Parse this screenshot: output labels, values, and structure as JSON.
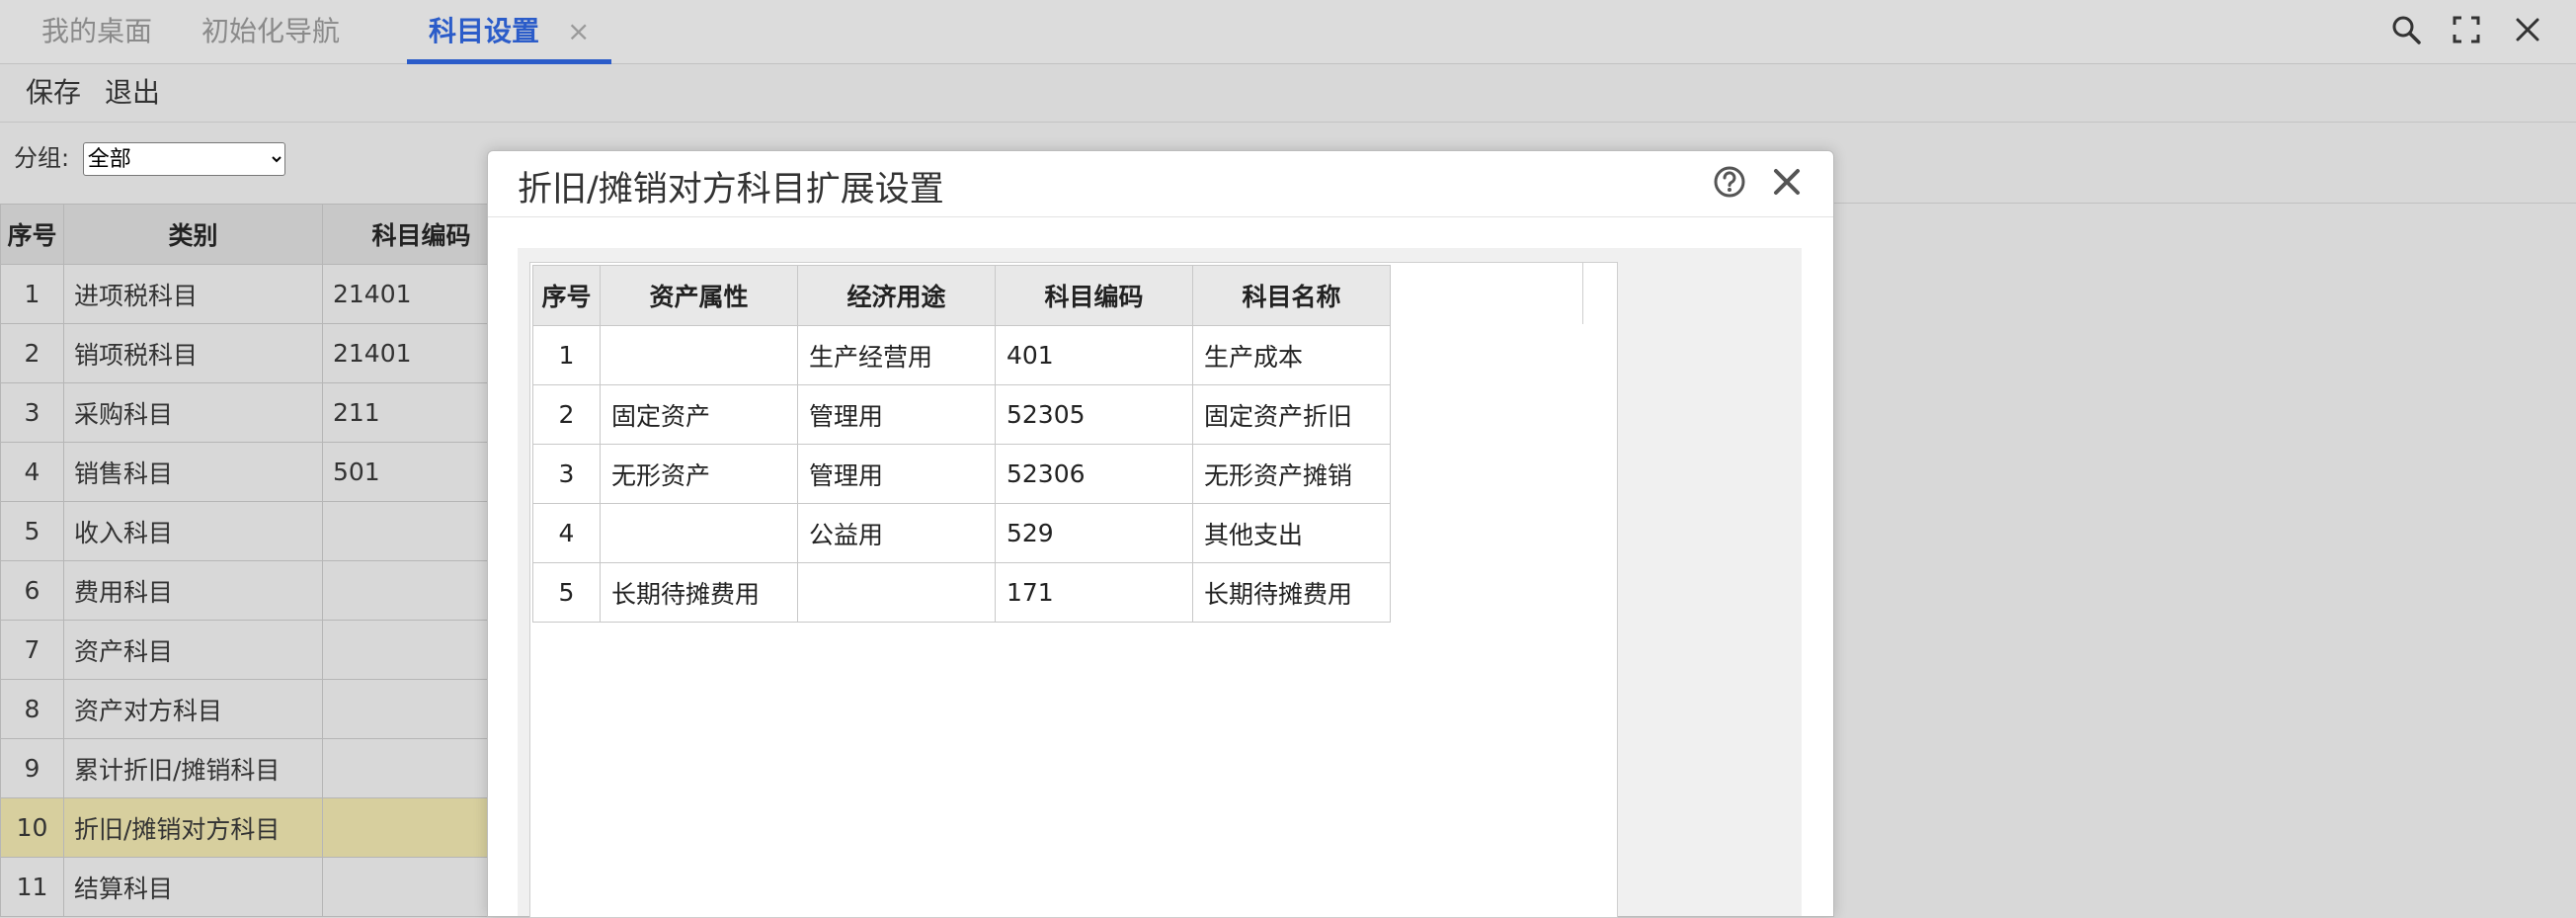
{
  "tabs": [
    {
      "label": "我的桌面"
    },
    {
      "label": "初始化导航"
    },
    {
      "label": "科目设置",
      "close": "×"
    }
  ],
  "toolbar": {
    "save_label": "保存",
    "exit_label": "退出"
  },
  "filter": {
    "label": "分组:",
    "selected": "全部"
  },
  "bg_table": {
    "headers": [
      "序号",
      "类别",
      "科目编码"
    ],
    "rows": [
      {
        "no": "1",
        "category": "进项税科目",
        "code": "21401"
      },
      {
        "no": "2",
        "category": "销项税科目",
        "code": "21401"
      },
      {
        "no": "3",
        "category": "采购科目",
        "code": "211"
      },
      {
        "no": "4",
        "category": "销售科目",
        "code": "501"
      },
      {
        "no": "5",
        "category": "收入科目",
        "code": ""
      },
      {
        "no": "6",
        "category": "费用科目",
        "code": ""
      },
      {
        "no": "7",
        "category": "资产科目",
        "code": ""
      },
      {
        "no": "8",
        "category": "资产对方科目",
        "code": ""
      },
      {
        "no": "9",
        "category": "累计折旧/摊销科目",
        "code": ""
      },
      {
        "no": "10",
        "category": "折旧/摊销对方科目",
        "code": ""
      },
      {
        "no": "11",
        "category": "结算科目",
        "code": ""
      }
    ],
    "selected_row": "10"
  },
  "modal": {
    "title": "折旧/摊销对方科目扩展设置",
    "table": {
      "headers": [
        "序号",
        "资产属性",
        "经济用途",
        "科目编码",
        "科目名称"
      ],
      "rows": [
        {
          "no": "1",
          "asset_attr": "",
          "usage": "生产经营用",
          "code": "401",
          "name": "生产成本"
        },
        {
          "no": "2",
          "asset_attr": "固定资产",
          "usage": "管理用",
          "code": "52305",
          "name": "固定资产折旧"
        },
        {
          "no": "3",
          "asset_attr": "无形资产",
          "usage": "管理用",
          "code": "52306",
          "name": "无形资产摊销"
        },
        {
          "no": "4",
          "asset_attr": "",
          "usage": "公益用",
          "code": "529",
          "name": "其他支出"
        },
        {
          "no": "5",
          "asset_attr": "长期待摊费用",
          "usage": "",
          "code": "171",
          "name": "长期待摊费用"
        }
      ]
    }
  },
  "colors": {
    "accent": "#2b5cc9",
    "highlight_row": "#d7cf9e"
  }
}
